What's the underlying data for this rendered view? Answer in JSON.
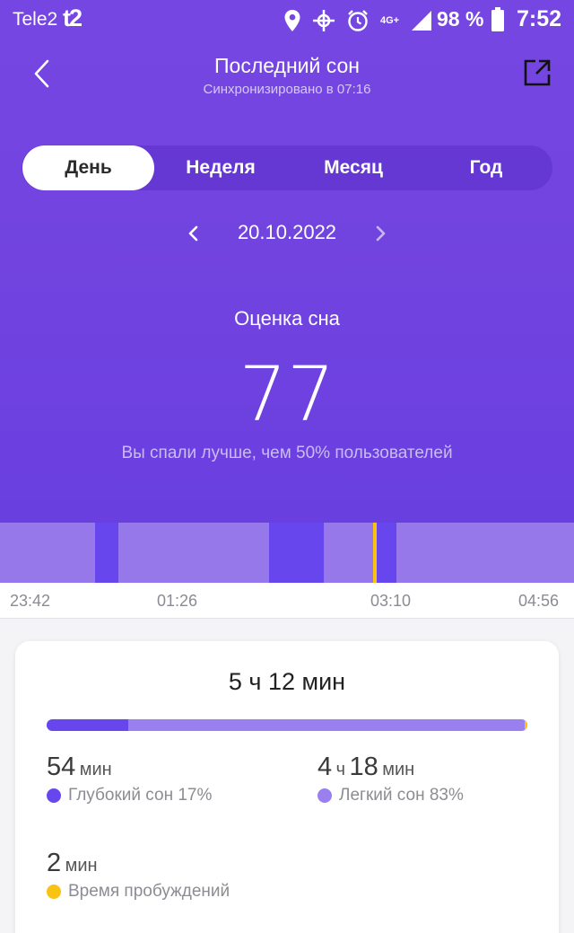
{
  "status_bar": {
    "carrier": "Tele2",
    "carrier_logo": "t2",
    "network": "4G+",
    "battery": "98 %",
    "battery_level": 98,
    "time": "7:52",
    "icons": [
      "location-icon",
      "cross-icon",
      "alarm-icon",
      "network-4g-icon",
      "signal-icon",
      "battery-icon"
    ]
  },
  "header": {
    "title": "Последний сон",
    "subtitle": "Синхронизировано в 07:16"
  },
  "tabs": [
    {
      "label": "День",
      "active": true
    },
    {
      "label": "Неделя",
      "active": false
    },
    {
      "label": "Месяц",
      "active": false
    },
    {
      "label": "Год",
      "active": false
    }
  ],
  "date": "20.10.2022",
  "score": {
    "label": "Оценка сна",
    "value": "77",
    "note": "Вы спали лучше, чем 50% пользователей"
  },
  "timeline": {
    "start": "23:42",
    "end": "04:56",
    "ticks": [
      "23:42",
      "01:26",
      "03:10",
      "04:56"
    ],
    "segments": [
      {
        "from": "23:42",
        "to": "00:34",
        "stage": "light"
      },
      {
        "from": "00:34",
        "to": "00:47",
        "stage": "deep"
      },
      {
        "from": "00:47",
        "to": "02:09",
        "stage": "light"
      },
      {
        "from": "02:09",
        "to": "02:39",
        "stage": "deep"
      },
      {
        "from": "02:39",
        "to": "03:06",
        "stage": "light"
      },
      {
        "from": "03:06",
        "to": "03:08",
        "stage": "awake"
      },
      {
        "from": "03:08",
        "to": "03:19",
        "stage": "deep"
      },
      {
        "from": "03:19",
        "to": "04:56",
        "stage": "light"
      }
    ]
  },
  "colors": {
    "light": "#9678ea",
    "deep": "#6846ee",
    "awake": "#f9c314",
    "accent": "#7344df"
  },
  "summary": {
    "total": "5 ч 12 мин",
    "deep_fraction": 0.17,
    "awake_fraction": 0.006,
    "deep": {
      "value": "54",
      "unit": "мин",
      "label": "Глубокий сон 17%"
    },
    "light": {
      "value1": "4",
      "unit1": "ч",
      "value2": "18",
      "unit2": "мин",
      "label": "Легкий сон 83%"
    },
    "awake": {
      "value": "2",
      "unit": "мин",
      "label": "Время пробуждений"
    }
  }
}
